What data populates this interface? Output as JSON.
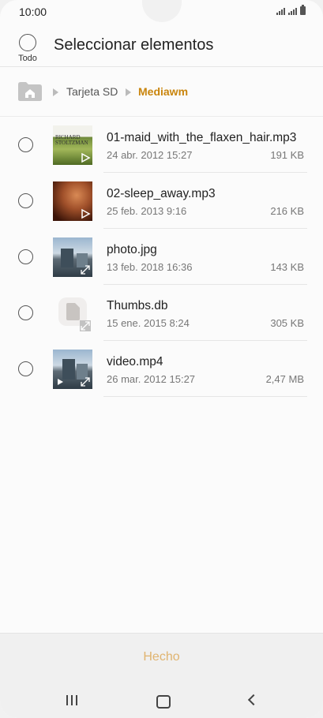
{
  "status_bar": {
    "time": "10:00"
  },
  "header": {
    "select_all_label": "Todo",
    "title": "Seleccionar elementos"
  },
  "breadcrumb": {
    "items": [
      "Tarjeta SD",
      "Mediawm"
    ]
  },
  "files": [
    {
      "name": "01-maid_with_the_flaxen_hair.mp3",
      "date": "24 abr. 2012 15:27",
      "size": "191 KB",
      "thumb_text": "RICHARD STOLTZMAN"
    },
    {
      "name": "02-sleep_away.mp3",
      "date": "25 feb. 2013 9:16",
      "size": "216 KB"
    },
    {
      "name": "photo.jpg",
      "date": "13 feb. 2018 16:36",
      "size": "143 KB"
    },
    {
      "name": "Thumbs.db",
      "date": "15 ene. 2015 8:24",
      "size": "305 KB"
    },
    {
      "name": "video.mp4",
      "date": "26 mar. 2012 15:27",
      "size": "2,47 MB"
    }
  ],
  "footer": {
    "done_label": "Hecho"
  },
  "colors": {
    "accent": "#c9850d",
    "done_disabled": "#e0b470"
  }
}
